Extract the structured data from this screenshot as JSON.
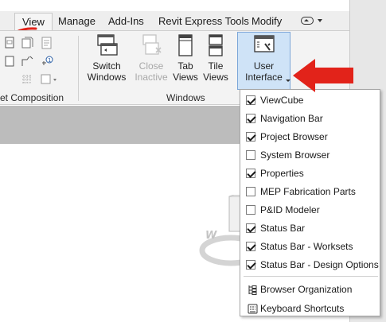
{
  "menubar": {
    "tabs": [
      "View",
      "Manage",
      "Add-Ins",
      "Revit Express Tools",
      "Modify"
    ],
    "active_tab": "View"
  },
  "ribbon": {
    "left_panel_label": "et Composition",
    "windows_panel_label": "Windows",
    "buttons": {
      "switch_windows": [
        "Switch",
        "Windows"
      ],
      "close_inactive": [
        "Close",
        "Inactive"
      ],
      "tab_views": [
        "Tab",
        "Views"
      ],
      "tile_views": [
        "Tile",
        "Views"
      ],
      "user_interface": [
        "User",
        "Interface"
      ]
    }
  },
  "viewcube_face": "W",
  "menu": {
    "items": [
      {
        "label": "ViewCube",
        "checked": true
      },
      {
        "label": "Navigation Bar",
        "checked": true
      },
      {
        "label": "Project Browser",
        "checked": true
      },
      {
        "label": "System Browser",
        "checked": false
      },
      {
        "label": "Properties",
        "checked": true
      },
      {
        "label": "MEP Fabrication Parts",
        "checked": false
      },
      {
        "label": "P&ID Modeler",
        "checked": false
      },
      {
        "label": "Status Bar",
        "checked": true
      },
      {
        "label": "Status Bar - Worksets",
        "checked": true
      },
      {
        "label": "Status Bar - Design Options",
        "checked": true
      }
    ],
    "actions": [
      {
        "label": "Browser Organization",
        "icon": "browser-organization-icon"
      },
      {
        "label": "Keyboard Shortcuts",
        "icon": "keyboard-shortcuts-icon"
      }
    ]
  },
  "colors": {
    "accent_arrow": "#e2231a",
    "underline": "#e2231a",
    "highlight": "#cfe3f7"
  }
}
